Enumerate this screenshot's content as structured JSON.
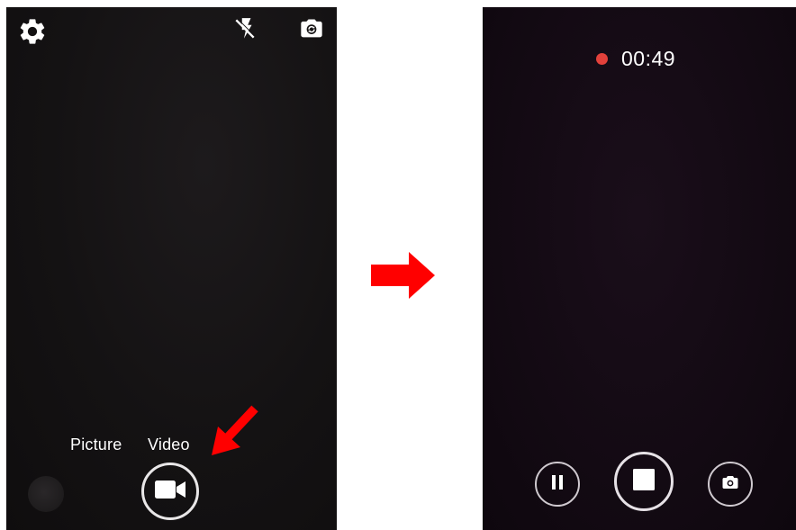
{
  "left": {
    "modes": [
      "Picture",
      "Video"
    ],
    "icons": {
      "settings": "gear-icon",
      "flash": "flash-off-icon",
      "switch_camera": "camera-switch-icon",
      "shutter": "video-camera-icon"
    }
  },
  "transition": {
    "icon": "arrow-right-icon",
    "color": "#ff0000"
  },
  "right": {
    "recording_time": "00:49",
    "recording_indicator_color": "#e2413b",
    "controls": [
      "pause-icon",
      "stop-icon",
      "camera-snapshot-icon"
    ]
  },
  "annotation": {
    "icon": "arrow-down-left-icon",
    "color": "#ff0000"
  }
}
